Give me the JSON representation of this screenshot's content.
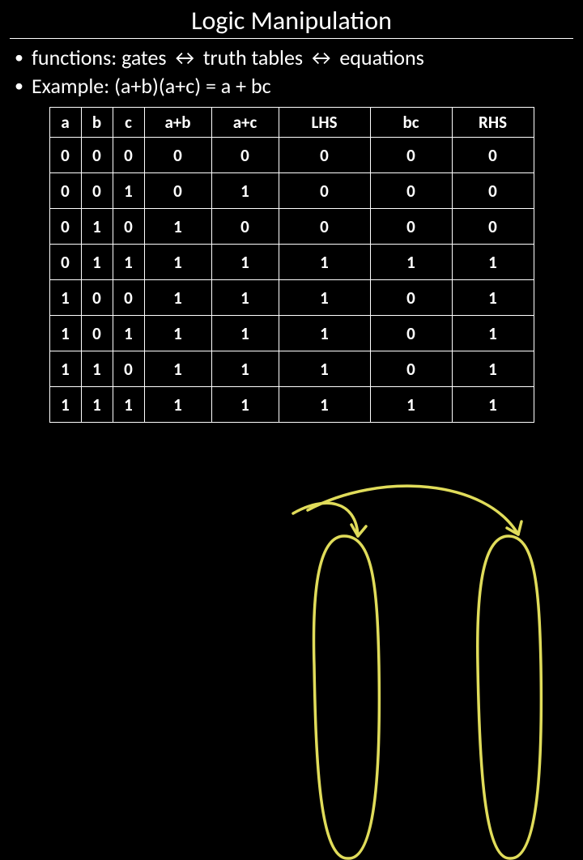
{
  "title": "Logic Manipulation",
  "bullets": [
    "functions: gates ↔ truth tables ↔ equations",
    "Example: (a+b)(a+c) = a + bc"
  ],
  "chart_data": {
    "type": "table",
    "columns": [
      "a",
      "b",
      "c",
      "a+b",
      "a+c",
      "LHS",
      "bc",
      "RHS"
    ],
    "rows": [
      [
        "0",
        "0",
        "0",
        "0",
        "0",
        "0",
        "0",
        "0"
      ],
      [
        "0",
        "0",
        "1",
        "0",
        "1",
        "0",
        "0",
        "0"
      ],
      [
        "0",
        "1",
        "0",
        "1",
        "0",
        "0",
        "0",
        "0"
      ],
      [
        "0",
        "1",
        "1",
        "1",
        "1",
        "1",
        "1",
        "1"
      ],
      [
        "1",
        "0",
        "0",
        "1",
        "1",
        "1",
        "0",
        "1"
      ],
      [
        "1",
        "0",
        "1",
        "1",
        "1",
        "1",
        "0",
        "1"
      ],
      [
        "1",
        "1",
        "0",
        "1",
        "1",
        "1",
        "0",
        "1"
      ],
      [
        "1",
        "1",
        "1",
        "1",
        "1",
        "1",
        "1",
        "1"
      ]
    ]
  },
  "annotation_color": "#e0dc5a"
}
